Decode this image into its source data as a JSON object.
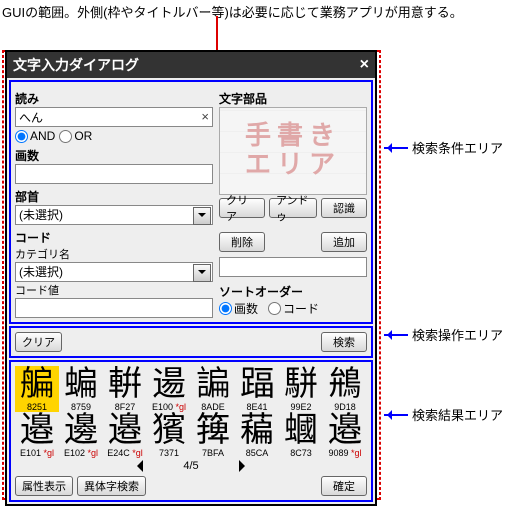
{
  "top_note": "GUIの範囲。外側(枠やタイトルバー等)は必要に応じて業務アプリが用意する。",
  "annotations": {
    "condition": "検索条件エリア",
    "operation": "検索操作エリア",
    "result": "検索結果エリア"
  },
  "window": {
    "title": "文字入力ダイアログ"
  },
  "cond": {
    "reading_label": "読み",
    "reading_value": "へん",
    "and_label": "AND",
    "or_label": "OR",
    "strokes_label": "画数",
    "radical_label": "部首",
    "radical_value": "(未選択)",
    "code_label": "コード",
    "category_label": "カテゴリ名",
    "category_value": "(未選択)",
    "codeval_label": "コード値",
    "moji_parts_label": "文字部品",
    "handwrite_placeholder": "手書き\nエリア",
    "btn_clear": "クリア",
    "btn_undo": "アンドゥ",
    "btn_recognize": "認識",
    "btn_delete": "削除",
    "btn_add": "追加",
    "sort_label": "ソートオーダー",
    "sort_strokes": "画数",
    "sort_code": "コード"
  },
  "ops": {
    "clear": "クリア",
    "search": "検索"
  },
  "results": {
    "page": "4/5",
    "row1": [
      {
        "ch": "艑",
        "code": "8251",
        "sel": true
      },
      {
        "ch": "蝙",
        "code": "8759"
      },
      {
        "ch": "輧",
        "code": "8F27"
      },
      {
        "ch": "逿",
        "code": "E100",
        "gl": true
      },
      {
        "ch": "諞",
        "code": "8ADE"
      },
      {
        "ch": "踾",
        "code": "8E41"
      },
      {
        "ch": "駢",
        "code": "99E2"
      },
      {
        "ch": "鴘",
        "code": "9D18"
      }
    ],
    "row2": [
      {
        "ch": "邉",
        "code": "E101",
        "gl": true
      },
      {
        "ch": "邊",
        "code": "E102",
        "gl": true
      },
      {
        "ch": "邉",
        "code": "E24C",
        "gl": true
      },
      {
        "ch": "獱",
        "code": "7371"
      },
      {
        "ch": "篺",
        "code": "7BFA"
      },
      {
        "ch": "藊",
        "code": "85CA"
      },
      {
        "ch": "蟈",
        "code": "8C73"
      },
      {
        "ch": "邉",
        "code": "9089",
        "gl": true
      }
    ],
    "btn_attr": "属性表示",
    "btn_variant": "異体字検索",
    "btn_confirm": "確定"
  }
}
